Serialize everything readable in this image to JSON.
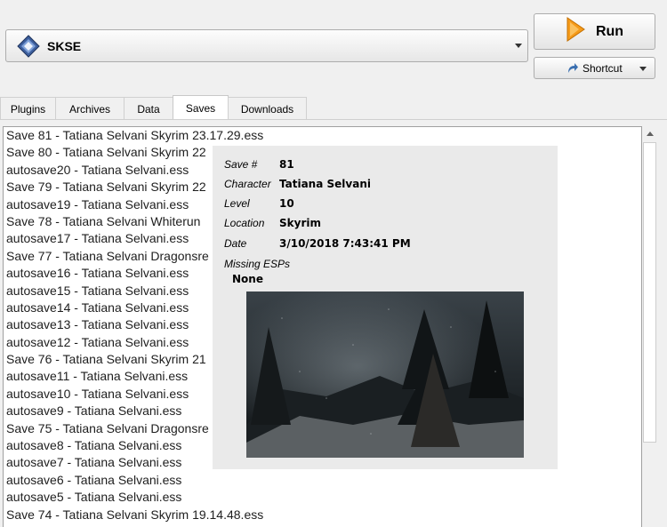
{
  "executable": {
    "selected": "SKSE",
    "icon": "skse-diamond-icon"
  },
  "toolbar": {
    "run_label": "Run",
    "run_icon": "play-triangle-icon",
    "shortcut_label": "Shortcut",
    "shortcut_icon": "shortcut-arrow-icon"
  },
  "tabs": [
    {
      "label": "Plugins",
      "active": false
    },
    {
      "label": "Archives",
      "active": false
    },
    {
      "label": "Data",
      "active": false
    },
    {
      "label": "Saves",
      "active": true
    },
    {
      "label": "Downloads",
      "active": false
    }
  ],
  "saves": [
    "Save 81 - Tatiana Selvani  Skyrim  23.17.29.ess",
    "Save 80 - Tatiana Selvani  Skyrim  22",
    "autosave20 - Tatiana Selvani.ess",
    "Save 79 - Tatiana Selvani  Skyrim  22",
    "autosave19 - Tatiana Selvani.ess",
    "Save 78 - Tatiana Selvani  Whiterun",
    "autosave17 - Tatiana Selvani.ess",
    "Save 77 - Tatiana Selvani  Dragonsre",
    "autosave16 - Tatiana Selvani.ess",
    "autosave15 - Tatiana Selvani.ess",
    "autosave14 - Tatiana Selvani.ess",
    "autosave13 - Tatiana Selvani.ess",
    "autosave12 - Tatiana Selvani.ess",
    "Save 76 - Tatiana Selvani  Skyrim  21",
    "autosave11 - Tatiana Selvani.ess",
    "autosave10 - Tatiana Selvani.ess",
    "autosave9 - Tatiana Selvani.ess",
    "Save 75 - Tatiana Selvani  Dragonsre",
    "autosave8 - Tatiana Selvani.ess",
    "autosave7 - Tatiana Selvani.ess",
    "autosave6 - Tatiana Selvani.ess",
    "autosave5 - Tatiana Selvani.ess",
    "Save 74 - Tatiana Selvani  Skyrim  19.14.48.ess"
  ],
  "tooltip": {
    "save_key": "Save #",
    "save_val": "81",
    "character_key": "Character",
    "character_val": "Tatiana Selvani",
    "level_key": "Level",
    "level_val": "10",
    "location_key": "Location",
    "location_val": "Skyrim",
    "date_key": "Date",
    "date_val": "3/10/2018 7:43:41 PM",
    "missing_key": "Missing ESPs",
    "missing_val": "None"
  },
  "colors": {
    "run_orange": "#f59b1a",
    "shortcut_blue": "#3a6fb0",
    "skse_blue": "#3d5f9e"
  }
}
